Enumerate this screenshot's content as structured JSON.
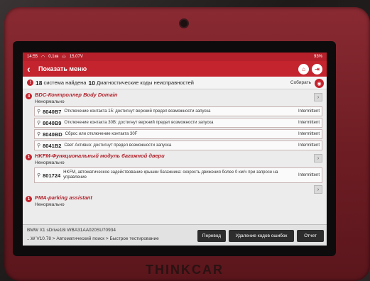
{
  "status_bar": {
    "time": "14:55",
    "voltage_icon": "wifi-icon",
    "voltage_label": "0,1кв",
    "battery_label": "15,07V",
    "battery_percent": "93%"
  },
  "header": {
    "title": "Показать меню"
  },
  "summary": {
    "systems_count": "18",
    "systems_text": "система найдена",
    "dtc_count": "10",
    "dtc_text": "Диагностические коды неисправностей",
    "collect_label": "Собирать"
  },
  "modules": [
    {
      "count": "4",
      "name": "BDC-Контроллер Body Domain",
      "status": "Ненормально",
      "codes": [
        {
          "code": "8040B7",
          "desc": "Отключение контакта 15: достигнут верхний предел возможности запуска",
          "status": "Intermittent"
        },
        {
          "code": "8040B9",
          "desc": "Отключение контакта 30В: достигнут верхний предел возможности запуска",
          "status": "Intermittent"
        },
        {
          "code": "8040BD",
          "desc": "Сброс или отключение контакта 30F",
          "status": "Intermittent"
        },
        {
          "code": "8041B2",
          "desc": "Свет Активно: достигнут предел возможности запуска",
          "status": "Intermittent"
        }
      ]
    },
    {
      "count": "1",
      "name": "HKFM-Функциональный модуль багажной двери",
      "status": "Ненормально",
      "codes": [
        {
          "code": "801724",
          "desc": "HKFM, автоматическое задействование крышки багажника: скорость движения более 0 км/ч при запросе на управление",
          "status": "Intermittent"
        }
      ]
    },
    {
      "count": "1",
      "name": "PMA-parking assistant",
      "status": "Ненормально",
      "codes": []
    }
  ],
  "footer": {
    "vehicle": "BMW  X1 sDrive18i  WBA31AA020SU70934",
    "path": "...W V10.78 > Автоматический поиск  > Быстрое тестирование",
    "translate_label": "Перевод",
    "clear_label": "Удаление кодов ошибок",
    "report_label": "Отчет"
  },
  "device": {
    "brand": "THINKCAR"
  },
  "colors": {
    "accent": "#c4242e",
    "module_title": "#b01e28",
    "device_frame": "#6f1d24"
  }
}
